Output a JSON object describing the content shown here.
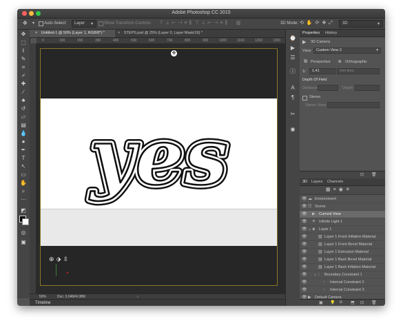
{
  "app": {
    "title": "Adobe Photoshop CC 2015"
  },
  "options_bar": {
    "auto_select_label": "Auto-Select:",
    "auto_select_value": "Layer",
    "show_transform_label": "Show Transform Controls",
    "mode_3d_label": "3D Mode:",
    "workspace_value": "3D"
  },
  "document_tabs": [
    {
      "label": "Untitled-1 @ 50% (Layer 1, RGB/8*) *",
      "close": "×"
    },
    {
      "label": "STEPS.psd @ 25% (Layer 0, Layer Mask/16) *",
      "close": "×"
    }
  ],
  "ruler": {
    "ticks": [
      "0",
      "100",
      "200",
      "300",
      "400",
      "500",
      "600",
      "700",
      "800",
      "900",
      "1000",
      "1100",
      "1200",
      "1300"
    ]
  },
  "canvas": {
    "word": "yes"
  },
  "status": {
    "zoom": "50%",
    "doc": "Doc: 3.04M/4.08M"
  },
  "timeline": {
    "label": "Timeline"
  },
  "properties_panel": {
    "tabs": [
      "Properties",
      "History"
    ],
    "section_title": "3D Camera",
    "view_label": "View:",
    "view_value": "Custom View 2",
    "perspective_label": "Perspective",
    "orthographic_label": "Orthographic",
    "field_value": "1.41",
    "field_label": "mm lens",
    "depth_of_field": "Depth Of Field",
    "distance_label": "Distance:",
    "depth_label": "Depth:",
    "stereo_label": "Stereo",
    "stereo_view_label": "Stereo View:"
  },
  "layers_panel": {
    "tabs": [
      "3D",
      "Layers",
      "Channels"
    ],
    "items": [
      {
        "label": "Environment",
        "icon": "environment-icon"
      },
      {
        "label": "Scene",
        "icon": "scene-icon"
      },
      {
        "label": "Current View",
        "icon": "camera-icon"
      },
      {
        "label": "Infinite Light 1",
        "icon": "light-icon"
      },
      {
        "label": "Layer 1",
        "icon": "mesh-icon"
      },
      {
        "label": "Layer 1 Front Inflation Material",
        "icon": "material-icon"
      },
      {
        "label": "Layer 1 Front Bevel Material",
        "icon": "material-icon"
      },
      {
        "label": "Layer 1 Extrusion Material",
        "icon": "material-icon"
      },
      {
        "label": "Layer 1 Back Bevel Material",
        "icon": "material-icon"
      },
      {
        "label": "Layer 1 Back Inflation Material",
        "icon": "material-icon"
      },
      {
        "label": "Boundary Constraint 1",
        "icon": "constraint-icon"
      },
      {
        "label": "Internal Constraint 2",
        "icon": "constraint-icon"
      },
      {
        "label": "Internal Constraint 3",
        "icon": "constraint-icon"
      },
      {
        "label": "Default Camera",
        "icon": "camera-icon"
      }
    ]
  },
  "colors": {
    "accent": "#8a7a2a",
    "panel": "#535353",
    "dark": "#262626"
  }
}
